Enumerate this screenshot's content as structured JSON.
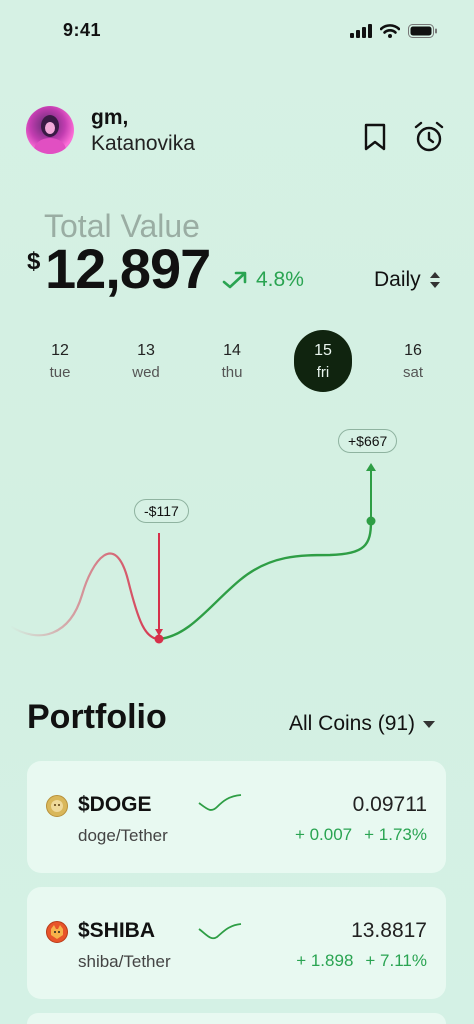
{
  "status": {
    "time": "9:41"
  },
  "header": {
    "greeting": "gm,",
    "username": "Katanovika",
    "icons": [
      "bookmark-icon",
      "alarm-clock-icon"
    ]
  },
  "summary": {
    "label": "Total Value",
    "currency": "$",
    "amount": "12,897",
    "change": "4.8%",
    "change_color": "#2aa452",
    "period": "Daily"
  },
  "days": [
    {
      "num": "12",
      "weekday": "tue",
      "active": false
    },
    {
      "num": "13",
      "weekday": "wed",
      "active": false
    },
    {
      "num": "14",
      "weekday": "thu",
      "active": false
    },
    {
      "num": "15",
      "weekday": "fri",
      "active": true
    },
    {
      "num": "16",
      "weekday": "sat",
      "active": false
    }
  ],
  "chart": {
    "loss_tag": "-$117",
    "gain_tag": "+$667",
    "loss_color": "#d6304a",
    "gain_color": "#2e9e45"
  },
  "portfolio": {
    "title": "Portfolio",
    "filter": "All Coins (91)",
    "coins": [
      {
        "symbol": "$DOGE",
        "pair": "doge/Tether",
        "price": "0.09711",
        "delta_abs": "+ 0.007",
        "delta_pct": "+ 1.73%",
        "icon": "doge-icon"
      },
      {
        "symbol": "$SHIBA",
        "pair": "shiba/Tether",
        "price": "13.8817",
        "delta_abs": "+ 1.898",
        "delta_pct": "+ 7.11%",
        "icon": "shiba-icon"
      }
    ]
  }
}
